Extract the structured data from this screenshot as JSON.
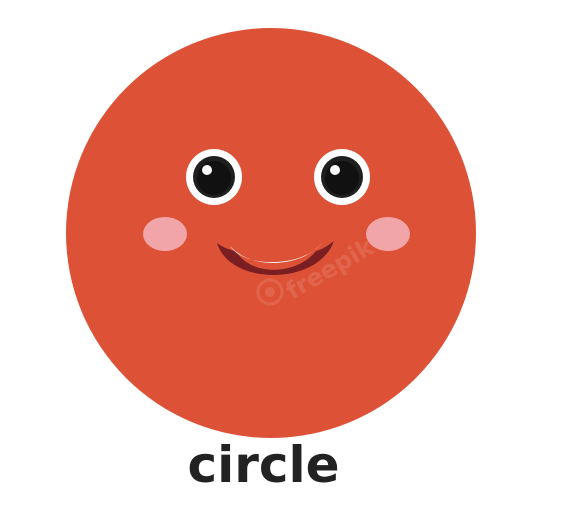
{
  "caption": {
    "text": "circle",
    "color": "#222222"
  },
  "colors": {
    "face": "#DD5236",
    "eye_white": "#FFFFFF",
    "eye_ring": "#1F1F1F",
    "pupil": "#111111",
    "eye_highlight": "#FFFFFF",
    "cheek": "#F2A5A9",
    "mouth_outline": "#7A1E22",
    "mouth_fill": "#FFFFFF",
    "watermark": "#E68A77"
  },
  "icons": {
    "face": "smiling-face-circle",
    "watermark": "freepik-watermark"
  },
  "watermark": {
    "text": "freepik"
  }
}
